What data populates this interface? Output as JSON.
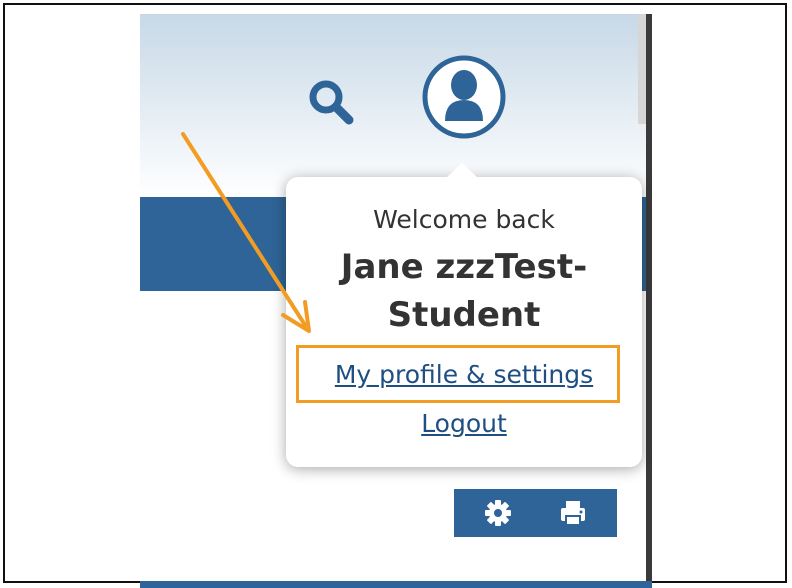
{
  "popover": {
    "welcome": "Welcome back",
    "user_line1": "Jane zzzTest-",
    "user_line2": "Student",
    "profile_link": "My profile & settings",
    "logout_link": "Logout"
  },
  "icons": {
    "search": "search-icon",
    "user": "user-avatar-icon",
    "settings": "gear-icon",
    "print": "print-icon"
  },
  "colors": {
    "brand_blue": "#2e6497",
    "link_blue": "#1f4f82",
    "highlight_orange": "#f39c24"
  }
}
